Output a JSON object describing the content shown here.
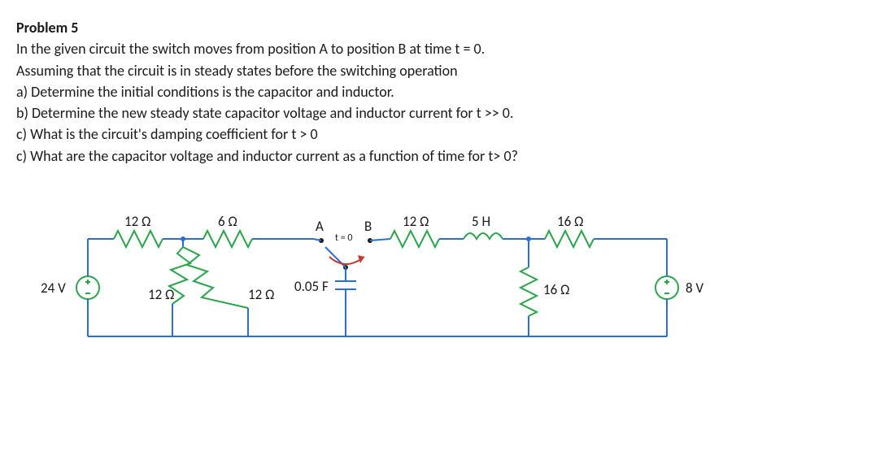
{
  "problem": {
    "heading": "Problem 5",
    "lines": [
      "In the given circuit the switch moves from position A to position B at time t = 0.",
      "Assuming that the circuit is in steady states before the switching operation",
      "a) Determine the initial conditions is the capacitor and inductor.",
      "b) Determine the new steady state capacitor voltage and inductor current for t >> 0.",
      "c) What is the circuit's damping coefficient for  t > 0",
      "c) What are the capacitor voltage and inductor current as a function of time for t> 0?"
    ]
  },
  "circuit": {
    "v_source_left": {
      "value": "24 V"
    },
    "v_source_right": {
      "value": "8 V"
    },
    "r_top_left_1": {
      "value": "12 Ω"
    },
    "r_top_left_2": {
      "value": "6 Ω"
    },
    "r_shunt_1": {
      "value": "12 Ω"
    },
    "r_shunt_2": {
      "value": "12 Ω"
    },
    "capacitor": {
      "value": "0.05 F"
    },
    "switch": {
      "posA": "A",
      "posB": "B",
      "time": "t = 0"
    },
    "r_top_right": {
      "value": "12 Ω"
    },
    "inductor": {
      "value": "5 H"
    },
    "r_top_far_right": {
      "value": "16 Ω"
    },
    "r_shunt_right": {
      "value": "16 Ω"
    }
  },
  "colors": {
    "wire": "#2a6fd6",
    "component": "#2aa54a",
    "source": "#2aa54a",
    "arrow": "#c0392b"
  }
}
